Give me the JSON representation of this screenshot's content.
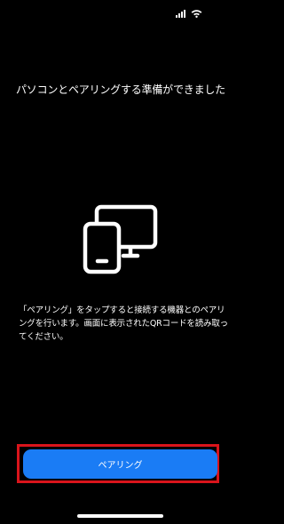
{
  "status_bar": {
    "signal_icon": "cellular-signal-icon",
    "wifi_icon": "wifi-icon"
  },
  "screen": {
    "title": "パソコンとペアリングする準備ができました",
    "illustration_icon": "phone-and-computer-icon",
    "instruction": "「ペアリング」をタップすると接続する機器とのペアリングを行います。画面に表示されたQRコードを読み取ってください。"
  },
  "actions": {
    "pair_button_label": "ペアリング",
    "highlight_color": "#d9141b",
    "accent_color": "#1a7cf5"
  }
}
